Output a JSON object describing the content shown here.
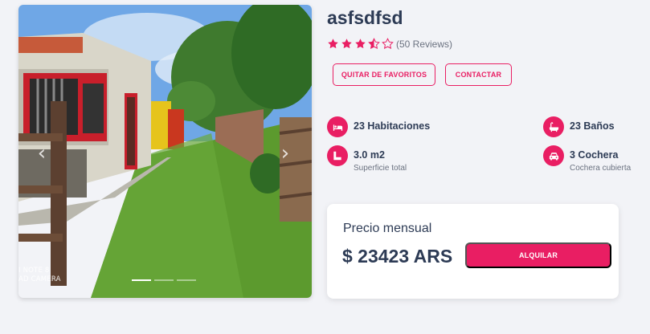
{
  "listing": {
    "title": "asfsdfsd",
    "rating": {
      "value": 3.5,
      "max": 5,
      "reviews_text": "(50 Reviews)"
    }
  },
  "actions": {
    "favorite_label": "QUITAR DE FAVORITOS",
    "contact_label": "CONTACTAR",
    "rent_label": "ALQUILAR"
  },
  "features": [
    {
      "icon": "bed-icon",
      "label": "23 Habitaciones",
      "sub": ""
    },
    {
      "icon": "bath-icon",
      "label": "23 Baños",
      "sub": ""
    },
    {
      "icon": "area-icon",
      "label": "3.0 m2",
      "sub": "Superficie total"
    },
    {
      "icon": "car-icon",
      "label": "3 Cochera",
      "sub": "Cochera cubierta"
    }
  ],
  "price": {
    "label": "Precio mensual",
    "value": "$ 23423 ARS"
  },
  "gallery": {
    "watermark_line1": "I NOTE 8",
    "watermark_line2": "AD CAMERA",
    "slide_count": 3,
    "active_slide": 0
  },
  "colors": {
    "accent": "#e91e63",
    "heading": "#2d3b55",
    "background": "#f2f3f7"
  }
}
